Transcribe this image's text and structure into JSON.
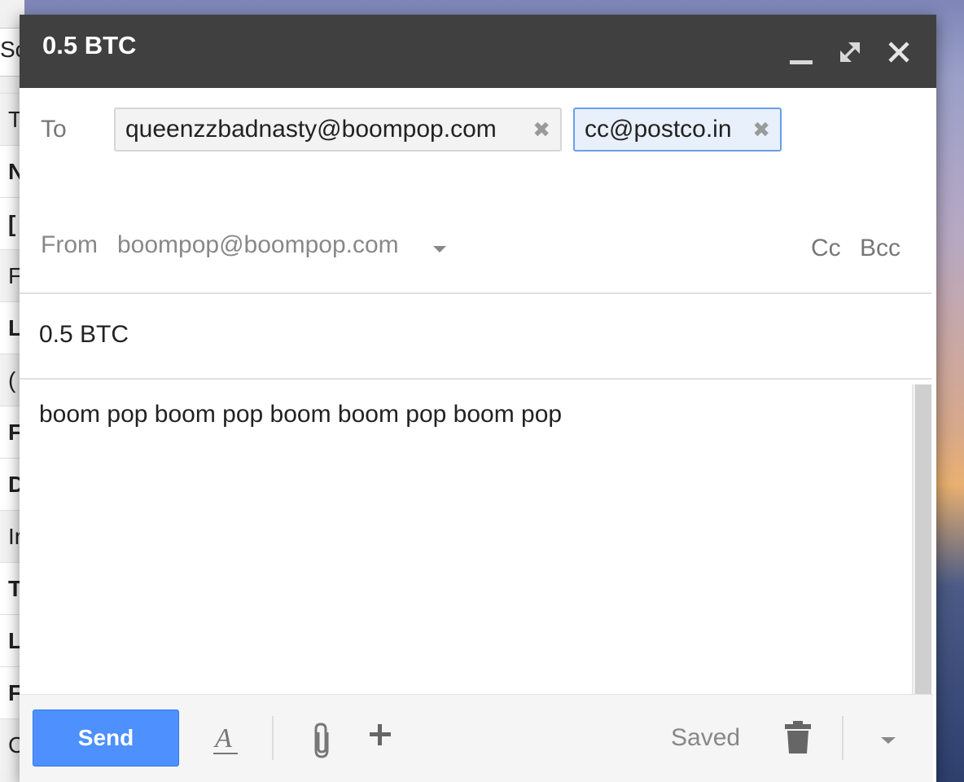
{
  "background": {
    "search_fragment": "Sc",
    "row_letters": [
      "T",
      "N",
      "[",
      "F",
      "L",
      "(",
      "F",
      "D",
      "Ir",
      "T",
      "L",
      "F",
      "C"
    ]
  },
  "compose": {
    "title": "0.5 BTC",
    "to_label": "To",
    "recipients": [
      {
        "email": "queenzzbadnasty@boompop.com",
        "selected": false
      },
      {
        "email": "cc@postco.in",
        "selected": true
      }
    ],
    "remove_glyph": "✖",
    "from_label": "From",
    "from_value": "boompop@boompop.com",
    "cc_label": "Cc",
    "bcc_label": "Bcc",
    "subject": "0.5 BTC",
    "body": "boom pop boom pop boom boom pop boom pop"
  },
  "footer": {
    "send_label": "Send",
    "status": "Saved"
  },
  "colors": {
    "titlebar": "#404040",
    "send_button": "#4d90fe",
    "selected_chip_border": "#6a9fe8"
  },
  "icons": [
    "minimize-icon",
    "expand-icon",
    "close-icon",
    "formatting-icon",
    "attach-icon",
    "plus-icon",
    "trash-icon",
    "more-options-icon"
  ]
}
